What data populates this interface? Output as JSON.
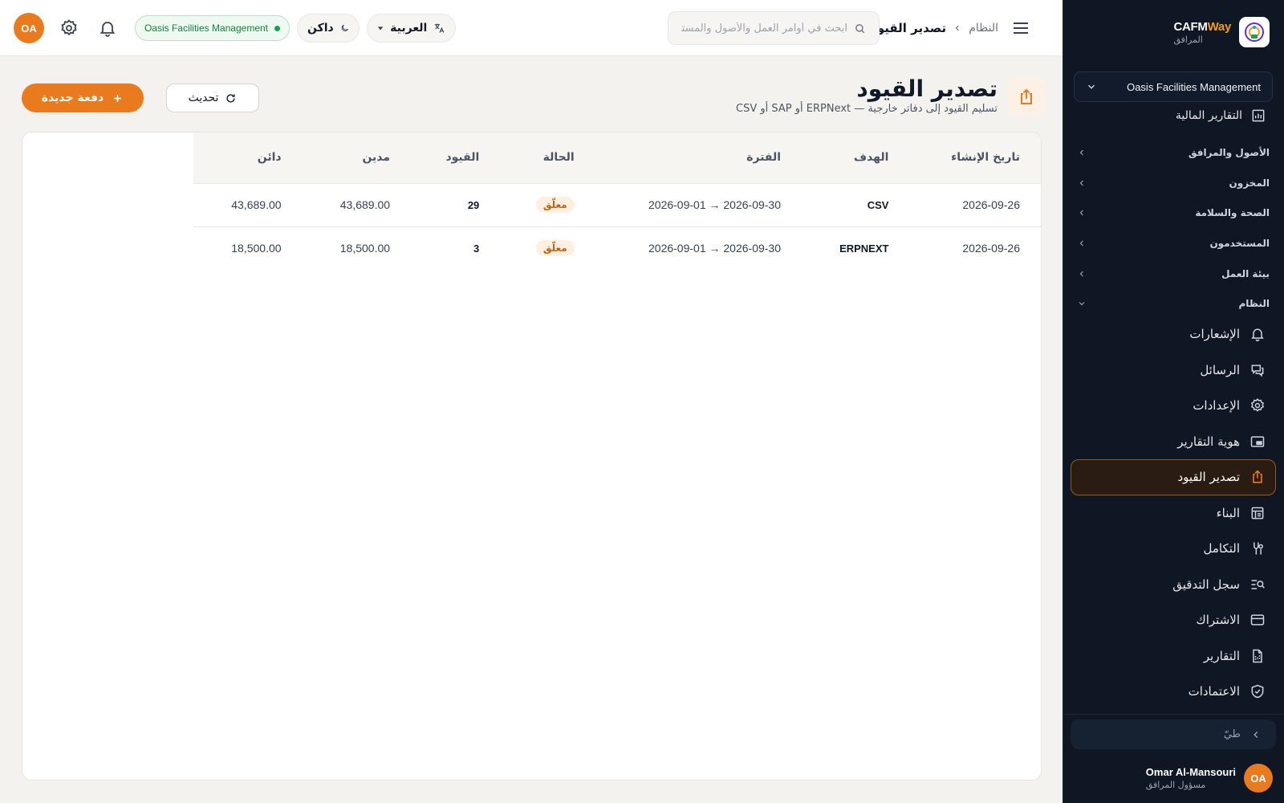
{
  "app": {
    "brand_primary": "CAFM",
    "brand_secondary": "Way",
    "brand_sub": "المرافق",
    "accent_color": "#ea7a1e",
    "sidebar_bg": "#0f1724"
  },
  "sidebar": {
    "org_select": "Oasis Facilities Management",
    "partial_item": "التقارير المالية",
    "groups": [
      {
        "label": "الأصول والمرافق",
        "expanded": false
      },
      {
        "label": "المخزون",
        "expanded": false
      },
      {
        "label": "الصحة والسلامة",
        "expanded": false
      },
      {
        "label": "المستخدمون",
        "expanded": false
      },
      {
        "label": "بيئة العمل",
        "expanded": false
      },
      {
        "label": "النظام",
        "expanded": true
      }
    ],
    "items": [
      {
        "label": "الإشعارات",
        "icon": "bell-icon"
      },
      {
        "label": "الرسائل",
        "icon": "messages-icon"
      },
      {
        "label": "الإعدادات",
        "icon": "gear-icon"
      },
      {
        "label": "هوية التقارير",
        "icon": "branding-icon"
      },
      {
        "label": "تصدير القيود",
        "icon": "export-icon",
        "active": true
      },
      {
        "label": "البناء",
        "icon": "builder-icon"
      },
      {
        "label": "التكامل",
        "icon": "integration-icon"
      },
      {
        "label": "سجل التدقيق",
        "icon": "audit-icon"
      },
      {
        "label": "الاشتراك",
        "icon": "card-icon"
      },
      {
        "label": "التقارير",
        "icon": "reports-icon"
      },
      {
        "label": "الاعتمادات",
        "icon": "shield-check-icon"
      }
    ],
    "collapse_label": "طيّ",
    "user": {
      "initials": "OA",
      "name": "Omar Al-Mansouri",
      "role": "مسؤول المرافق"
    }
  },
  "topbar": {
    "breadcrumb_parent": "النظام",
    "breadcrumb_current": "تصدير القيود",
    "search_placeholder": "ابحث في أوامر العمل والأصول والمستأجرين",
    "language": "العربية",
    "theme": "داكن",
    "org_badge": "Oasis Facilities Management",
    "avatar_initials": "OA"
  },
  "page": {
    "title": "تصدير القيود",
    "subtitle": "تسليم القيود إلى دفاتر خارجية — ERPNext أو SAP أو CSV",
    "refresh_label": "تحديث",
    "new_batch_label": "دفعة جديدة"
  },
  "table": {
    "columns": [
      "تاريخ الإنشاء",
      "الهدف",
      "الفترة",
      "الحالة",
      "القيود",
      "مدين",
      "دائن"
    ],
    "rows": [
      {
        "created": "2026-09-26",
        "target": "CSV",
        "period": "2026-09-01 → 2026-09-30",
        "status": "معلّق",
        "entries": "29",
        "debit": "43,689.00",
        "credit": "43,689.00"
      },
      {
        "created": "2026-09-26",
        "target": "ERPNEXT",
        "period": "2026-09-01 → 2026-09-30",
        "status": "معلّق",
        "entries": "3",
        "debit": "18,500.00",
        "credit": "18,500.00"
      }
    ]
  }
}
